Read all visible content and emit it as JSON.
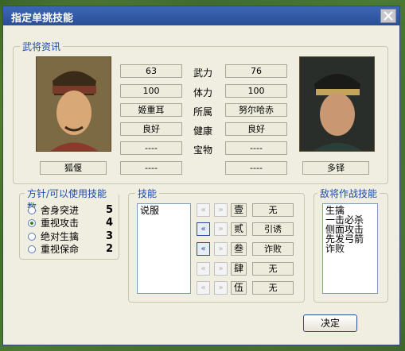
{
  "window": {
    "title": "指定单挑技能"
  },
  "general_info": {
    "legend": "武将资讯",
    "left": {
      "name": "狐偃",
      "wuli": "63",
      "tili": "100",
      "affiliation": "姬重耳",
      "health": "良好",
      "treasure": "----",
      "extra": "----"
    },
    "right": {
      "name": "多铎",
      "wuli": "76",
      "tili": "100",
      "affiliation": "努尔哈赤",
      "health": "良好",
      "treasure": "----",
      "extra": "----"
    },
    "labels": {
      "wuli": "武力",
      "tili": "体力",
      "affiliation": "所属",
      "health": "健康",
      "treasure": "宝物"
    }
  },
  "policy": {
    "legend": "方针/可以使用技能数",
    "options": [
      {
        "label": "舍身突进",
        "count": "5",
        "selected": false
      },
      {
        "label": "重视攻击",
        "count": "4",
        "selected": true
      },
      {
        "label": "绝对生擒",
        "count": "3",
        "selected": false
      },
      {
        "label": "重视保命",
        "count": "2",
        "selected": false
      }
    ]
  },
  "skills": {
    "legend": "技能",
    "available": [
      "说服"
    ],
    "slots": [
      {
        "num": "壹",
        "value": "无"
      },
      {
        "num": "贰",
        "value": "引诱"
      },
      {
        "num": "叁",
        "value": "诈败"
      },
      {
        "num": "肆",
        "value": "无"
      },
      {
        "num": "伍",
        "value": "无"
      }
    ]
  },
  "enemy_skills": {
    "legend": "敌将作战技能",
    "items": [
      "生擒",
      "一击必杀",
      "侧面攻击",
      "先发弓箭",
      "诈败"
    ]
  },
  "buttons": {
    "ok": "决定",
    "arrow_left": "«",
    "arrow_right": "»"
  },
  "colors": {
    "title_bar": "#2a4f96",
    "legend": "#1f4aa8",
    "panel": "#f0eee0"
  }
}
